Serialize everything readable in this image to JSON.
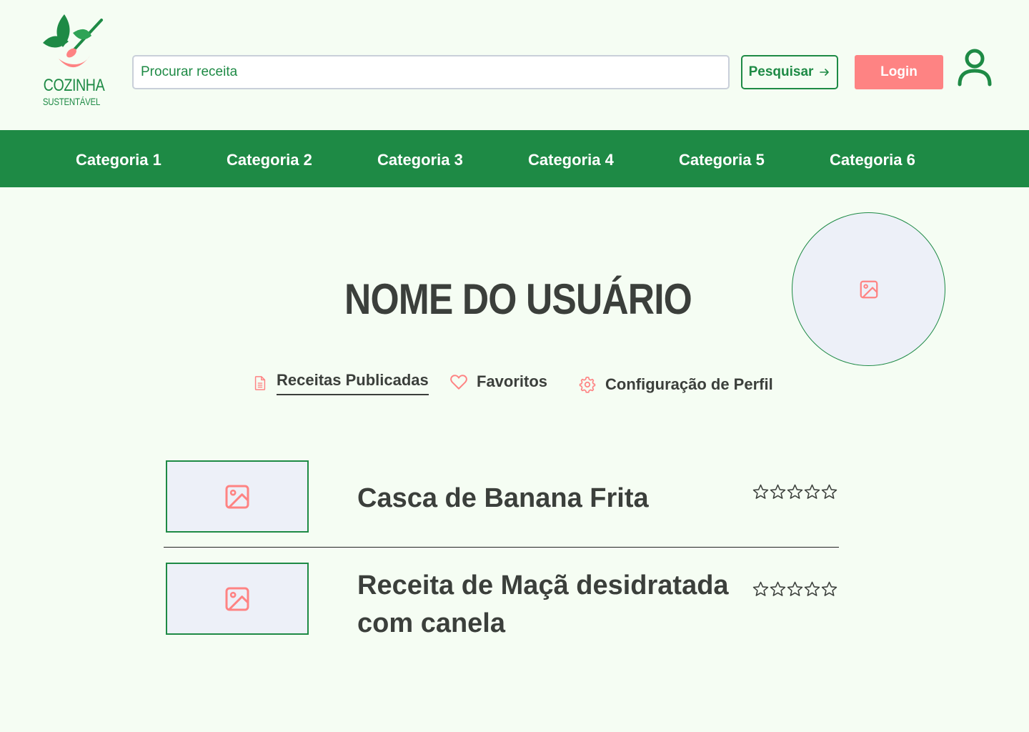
{
  "app": {
    "logo_title": "COZINHA",
    "logo_subtitle": "SUSTENTÁVEL"
  },
  "header": {
    "search_placeholder": "Procurar receita",
    "search_button": "Pesquisar",
    "login_button": "Login"
  },
  "nav": {
    "categories": [
      "Categoria 1",
      "Categoria 2",
      "Categoria 3",
      "Categoria 4",
      "Categoria 5",
      "Categoria 6"
    ]
  },
  "profile": {
    "user_name": "NOME DO USUÁRIO",
    "tabs": [
      {
        "label": "Receitas Publicadas",
        "icon": "document-icon",
        "active": true
      },
      {
        "label": "Favoritos",
        "icon": "heart-icon",
        "active": false
      },
      {
        "label": "Configuração de Perfil",
        "icon": "gear-icon",
        "active": false
      }
    ]
  },
  "recipes": [
    {
      "title": "Casca de Banana Frita",
      "rating": 0,
      "max_rating": 5
    },
    {
      "title": "Receita de Maçã desidratada com canela",
      "rating": 0,
      "max_rating": 5
    }
  ],
  "colors": {
    "brand_green": "#1e8a45",
    "accent_coral": "#fe8383",
    "background": "#f5fdf3",
    "placeholder_bg": "#edf0f8",
    "text_dark": "#3b3f3b"
  }
}
